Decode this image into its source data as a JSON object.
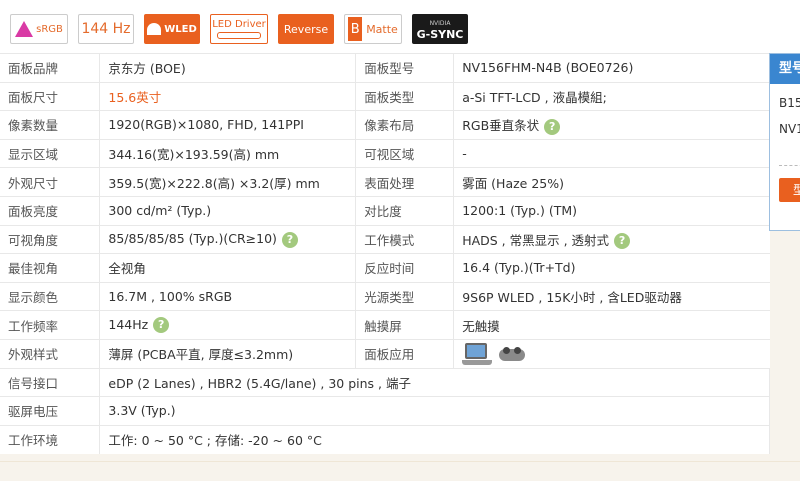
{
  "badges": {
    "srgb": "sRGB",
    "hz": "144 Hz",
    "wled": "WLED",
    "led_driver": "LED Driver",
    "reverse": "Reverse",
    "matte_letter": "B",
    "matte": "Matte",
    "gsync_top": "NVIDIA",
    "gsync": "G-SYNC"
  },
  "rows": [
    {
      "l1": "面板品牌",
      "v1": "京东方 (BOE)",
      "l2": "面板型号",
      "v2": "NV156FHM-N4B (BOE0726)"
    },
    {
      "l1": "面板尺寸",
      "v1": "15.6英寸",
      "l2": "面板类型",
      "v2": "a-Si TFT-LCD , 液晶模組;"
    },
    {
      "l1": "像素数量",
      "v1": "1920(RGB)×1080, FHD, 141PPI",
      "l2": "像素布局",
      "v2": "RGB垂直条状"
    },
    {
      "l1": "显示区域",
      "v1": "344.16(宽)×193.59(高) mm",
      "l2": "可视区域",
      "v2": "-"
    },
    {
      "l1": "外观尺寸",
      "v1": "359.5(宽)×222.8(高) ×3.2(厚) mm",
      "l2": "表面处理",
      "v2": "雾面 (Haze 25%)"
    },
    {
      "l1": "面板亮度",
      "v1": "300 cd/m² (Typ.)",
      "l2": "对比度",
      "v2": "1200:1 (Typ.) (TM)"
    },
    {
      "l1": "可视角度",
      "v1": "85/85/85/85 (Typ.)(CR≥10)",
      "l2": "工作模式",
      "v2": "HADS , 常黑显示 , 透射式"
    },
    {
      "l1": "最佳视角",
      "v1": "全视角",
      "l2": "反应时间",
      "v2": "16.4 (Typ.)(Tr+Td)"
    },
    {
      "l1": "显示颜色",
      "v1": "16.7M , 100% sRGB",
      "l2": "光源类型",
      "v2": "9S6P WLED , 15K小时 , 含LED驱动器"
    },
    {
      "l1": "工作频率",
      "v1": "144Hz",
      "l2": "触摸屏",
      "v2": "无触摸"
    },
    {
      "l1": "外观样式",
      "v1": "薄屏 (PCBA平直, 厚度≤3.2mm)",
      "l2": "面板应用",
      "v2": ""
    }
  ],
  "wide_rows": [
    {
      "l": "信号接口",
      "v": "eDP (2 Lanes) , HBR2 (5.4G/lane) , 30 pins , 端子"
    },
    {
      "l": "驱屏电压",
      "v": "3.3V (Typ.)"
    },
    {
      "l": "工作环境",
      "v": "工作: 0 ~ 50 °C ; 存储: -20 ~ 60 °C"
    }
  ],
  "help_symbol": "?",
  "float_panel": {
    "title": "型号",
    "line1": "B15",
    "line2": "NV1",
    "button": "型"
  }
}
